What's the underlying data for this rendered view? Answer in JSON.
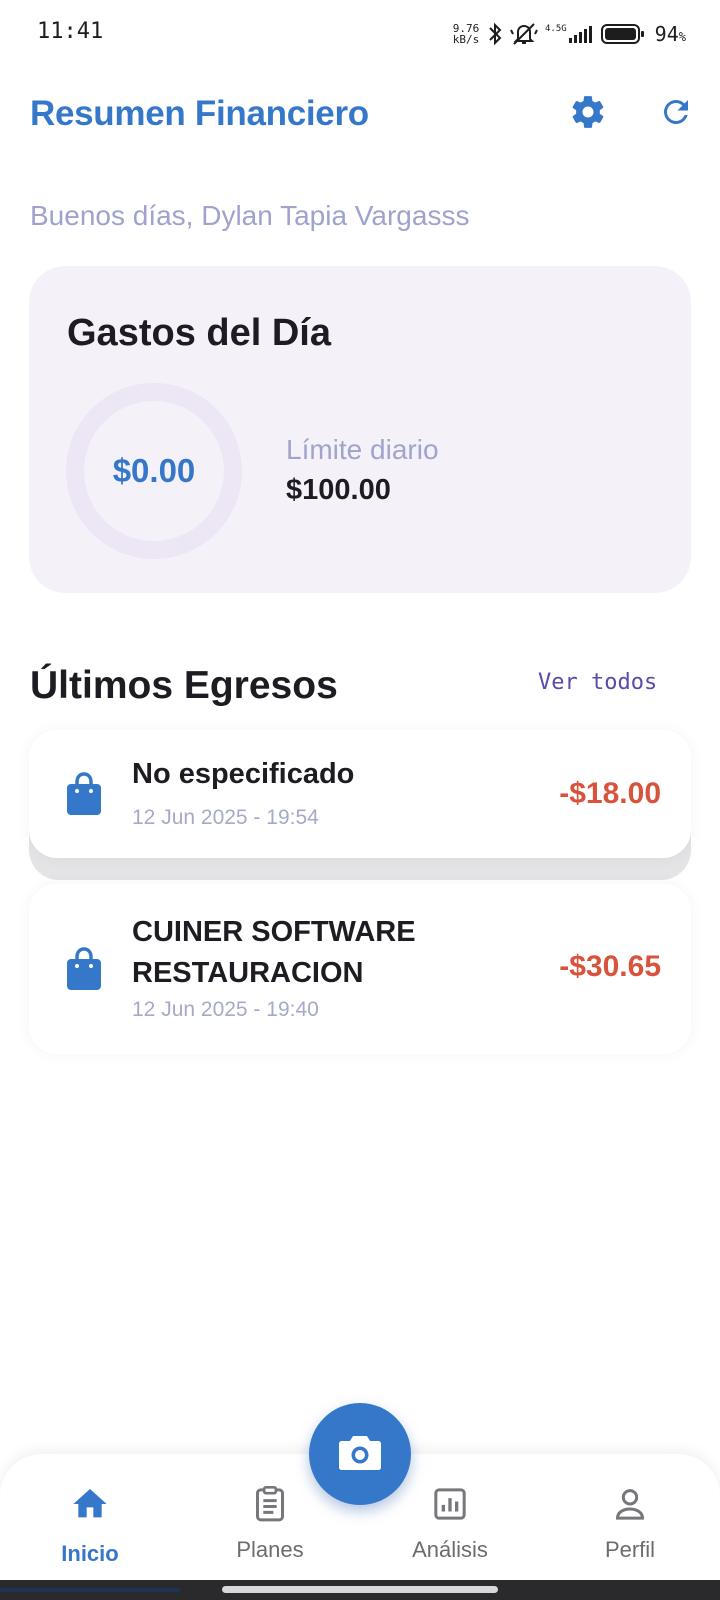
{
  "status_bar": {
    "time": "11:41",
    "net_speed_value": "9.76",
    "net_speed_unit": "kB/s",
    "signal_label": "4.5G",
    "battery": "94",
    "battery_suffix": "%"
  },
  "header": {
    "title": "Resumen Financiero",
    "settings_icon": "gear-icon",
    "refresh_icon": "refresh-icon"
  },
  "greeting": "Buenos días, Dylan Tapia Vargasss",
  "daily_card": {
    "title": "Gastos del Día",
    "spent": "$0.00",
    "spent_fraction": 0,
    "limit_label": "Límite diario",
    "limit_value": "$100.00"
  },
  "expenses": {
    "title": "Últimos Egresos",
    "see_all": "Ver todos",
    "items": [
      {
        "name": "No especificado",
        "date": "12 Jun 2025 - 19:54",
        "amount": "-$18.00",
        "icon": "shopping-bag-icon"
      },
      {
        "name": "CUINER SOFTWARE RESTAURACION",
        "date": "12 Jun 2025 - 19:40",
        "amount": "-$30.65",
        "icon": "shopping-bag-icon"
      }
    ]
  },
  "bottom_nav": {
    "items": [
      {
        "label": "Inicio",
        "icon": "home-icon",
        "active": true
      },
      {
        "label": "Planes",
        "icon": "clipboard-icon",
        "active": false
      },
      {
        "label": "Análisis",
        "icon": "bar-chart-icon",
        "active": false
      },
      {
        "label": "Perfil",
        "icon": "person-icon",
        "active": false
      }
    ],
    "fab_icon": "camera-icon"
  },
  "colors": {
    "primary": "#3578c9",
    "negative_amount": "#d9533c",
    "card_background": "#f5f1f9",
    "muted_text": "#9ea3cd"
  }
}
